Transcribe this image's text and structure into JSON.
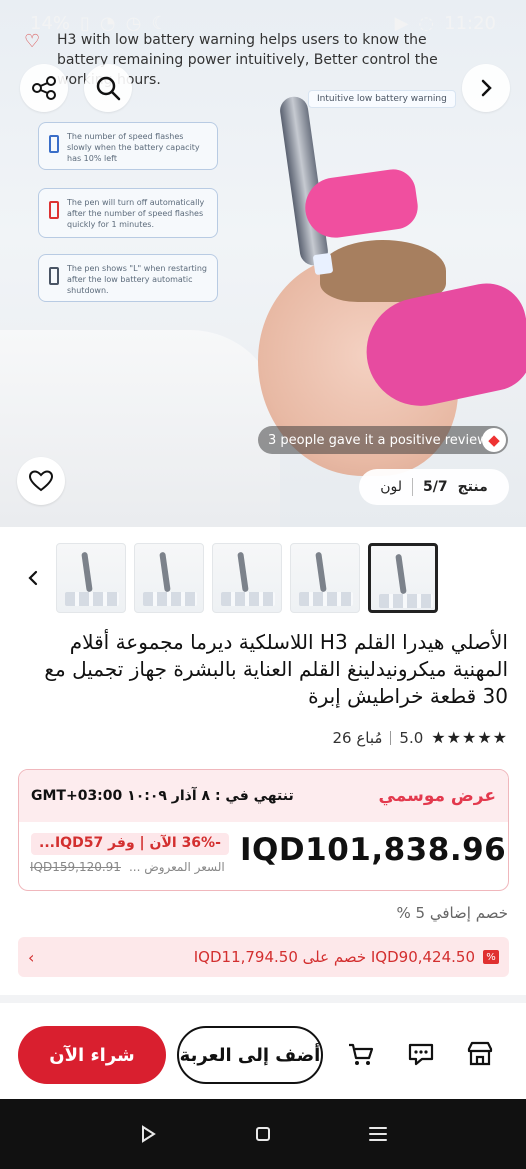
{
  "status_bar": {
    "battery_percent": "14%",
    "time": "11:20"
  },
  "hero": {
    "caption": "H3 with low battery warning helps users to know the battery remaining power intuitively, Better control the working hours.",
    "warning_tag": "Intuitive low battery warning",
    "cards": [
      "The number of speed flashes slowly when the battery capacity has 10% left",
      "The pen will turn off automatically after the number of speed flashes quickly for 1 minutes.",
      "The pen shows \"L\" when restarting after the low battery automatic shutdown."
    ],
    "review_pill": "3 people gave it a positive review",
    "counter_label": "منتج",
    "counter_value": "5/7",
    "color_label": "لون"
  },
  "product": {
    "title": "الأصلي هيدرا القلم H3 اللاسلكية ديرما مجموعة أقلام المهنية ميكرونيدلينغ القلم العناية بالبشرة جهاز تجميل مع 30 قطعة خراطيش إبرة",
    "rating": "5.0",
    "rating_stars": "★★★★★",
    "sold": "26 مُباع",
    "promo_label": "عرض موسمي",
    "ends_label": "تنتهي في : ٨ آذار ١٠:٠٩ GMT+03:00",
    "price": "IQD101,838.96",
    "discount_text": "-36% الآن | وفر IQD57...",
    "old_price_label": "السعر المعروض ...",
    "old_price": "IQD159,120.91",
    "extra_discount": "خصم إضافي 5 %",
    "coupon_text": "IQD90,424.50 خصم على IQD11,794.50",
    "coupon_badge": "%"
  },
  "actions": {
    "buy_now": "شراء الآن",
    "add_to_cart": "أضف إلى العربة"
  },
  "colors": {
    "primary_red": "#d91f2f",
    "promo_bg": "#fdecee",
    "coupon_bg": "#fde8ea"
  },
  "icons": {
    "share": "share-icon",
    "search": "search-icon",
    "next": "chevron-right-icon",
    "heart": "heart-icon",
    "fire": "fire-icon",
    "back": "chevron-left-icon",
    "cart": "cart-icon",
    "chat": "chat-icon",
    "store": "store-icon"
  }
}
